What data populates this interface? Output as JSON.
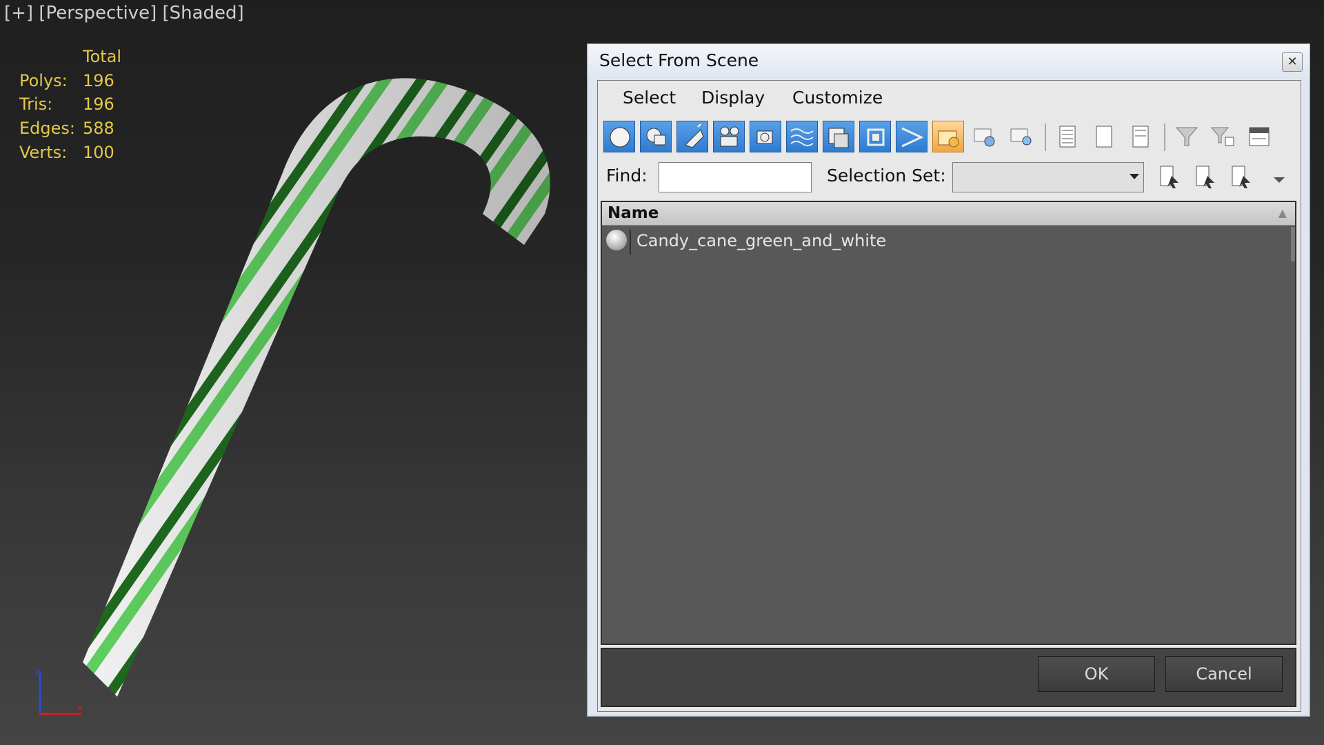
{
  "viewport": {
    "label_parts": [
      "[+]",
      "[Perspective]",
      "[Shaded]"
    ],
    "stats": {
      "header": "Total",
      "rows": [
        {
          "label": "Polys:",
          "value": "196"
        },
        {
          "label": "Tris:",
          "value": "196"
        },
        {
          "label": "Edges:",
          "value": "588"
        },
        {
          "label": "Verts:",
          "value": "100"
        }
      ]
    },
    "axis": {
      "z": "z",
      "x": "x"
    },
    "colors": {
      "stats_text": "#e3c84a",
      "stripe_dark": "#1f6a1f",
      "stripe_light": "#5fcf5f"
    }
  },
  "dialog": {
    "title": "Select From Scene",
    "close_icon": "close-icon",
    "menu": [
      "Select",
      "Display",
      "Customize"
    ],
    "toolbar_icons": [
      {
        "name": "geometry-filter-icon",
        "active": true
      },
      {
        "name": "shapes-filter-icon",
        "active": true
      },
      {
        "name": "lights-filter-icon",
        "active": true
      },
      {
        "name": "cameras-filter-icon",
        "active": true
      },
      {
        "name": "helpers-filter-icon",
        "active": true
      },
      {
        "name": "spacewarps-filter-icon",
        "active": true
      },
      {
        "name": "groups-filter-icon",
        "active": true
      },
      {
        "name": "xrefs-filter-icon",
        "active": true
      },
      {
        "name": "bones-filter-icon",
        "active": true
      },
      {
        "name": "containers-filter-icon",
        "active": true
      },
      {
        "name": "frozen-filter-icon",
        "active": false
      },
      {
        "name": "hidden-filter-icon",
        "active": false
      },
      {
        "name": "display-all-icon",
        "active": false
      },
      {
        "name": "display-none-icon",
        "active": false
      },
      {
        "name": "display-invert-icon",
        "active": false
      },
      {
        "name": "filter-icon",
        "active": false
      },
      {
        "name": "filter-options-icon",
        "active": false
      },
      {
        "name": "collapse-icon",
        "active": false
      }
    ],
    "find": {
      "label": "Find:",
      "value": ""
    },
    "selection_set": {
      "label": "Selection Set:",
      "value": ""
    },
    "list": {
      "column": "Name",
      "items": [
        {
          "name": "Candy_cane_green_and_white"
        }
      ]
    },
    "buttons": {
      "ok": "OK",
      "cancel": "Cancel"
    }
  }
}
